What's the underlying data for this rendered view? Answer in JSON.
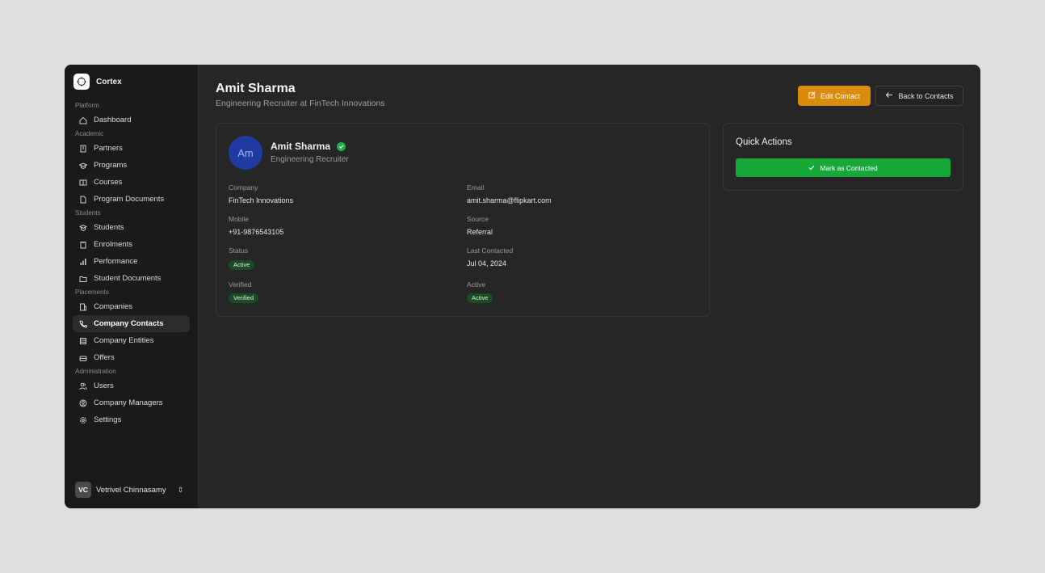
{
  "brand": {
    "name": "Cortex"
  },
  "sidebar": {
    "sections": [
      {
        "label": "Platform",
        "items": [
          {
            "label": "Dashboard",
            "icon": "home-icon"
          }
        ]
      },
      {
        "label": "Academic",
        "items": [
          {
            "label": "Partners",
            "icon": "building-icon"
          },
          {
            "label": "Programs",
            "icon": "graduation-cap-icon"
          },
          {
            "label": "Courses",
            "icon": "book-icon"
          },
          {
            "label": "Program Documents",
            "icon": "file-icon"
          }
        ]
      },
      {
        "label": "Students",
        "items": [
          {
            "label": "Students",
            "icon": "students-icon"
          },
          {
            "label": "Enrolments",
            "icon": "clipboard-icon"
          },
          {
            "label": "Performance",
            "icon": "bar-chart-icon"
          },
          {
            "label": "Student Documents",
            "icon": "folder-icon"
          }
        ]
      },
      {
        "label": "Placements",
        "items": [
          {
            "label": "Companies",
            "icon": "building-icon"
          },
          {
            "label": "Company Contacts",
            "icon": "phone-icon",
            "active": true
          },
          {
            "label": "Company Entities",
            "icon": "database-icon"
          },
          {
            "label": "Offers",
            "icon": "briefcase-icon"
          }
        ]
      },
      {
        "label": "Administration",
        "items": [
          {
            "label": "Users",
            "icon": "users-icon"
          },
          {
            "label": "Company Managers",
            "icon": "user-circle-icon"
          },
          {
            "label": "Settings",
            "icon": "gear-icon"
          }
        ]
      }
    ],
    "user": {
      "initials": "VC",
      "name": "Vetrivel Chinnasamy"
    }
  },
  "header": {
    "title": "Amit Sharma",
    "subtitle": "Engineering Recruiter at FinTech Innovations",
    "edit_label": "Edit Contact",
    "back_label": "Back to Contacts"
  },
  "contact": {
    "initials": "Am",
    "name": "Amit Sharma",
    "role": "Engineering Recruiter",
    "fields": {
      "company_label": "Company",
      "company": "FinTech Innovations",
      "email_label": "Email",
      "email": "amit.sharma@flipkart.com",
      "mobile_label": "Mobile",
      "mobile": "+91-9876543105",
      "source_label": "Source",
      "source": "Referral",
      "status_label": "Status",
      "status": "Active",
      "last_contacted_label": "Last Contacted",
      "last_contacted": "Jul 04, 2024",
      "verified_label": "Verified",
      "verified": "Verified",
      "active_label": "Active",
      "active": "Active"
    }
  },
  "quick_actions": {
    "title": "Quick Actions",
    "mark_label": "Mark as Contacted"
  },
  "colors": {
    "accent_orange": "#d98b0b",
    "success_green": "#18a83a",
    "avatar_blue": "#1f3aa0"
  }
}
